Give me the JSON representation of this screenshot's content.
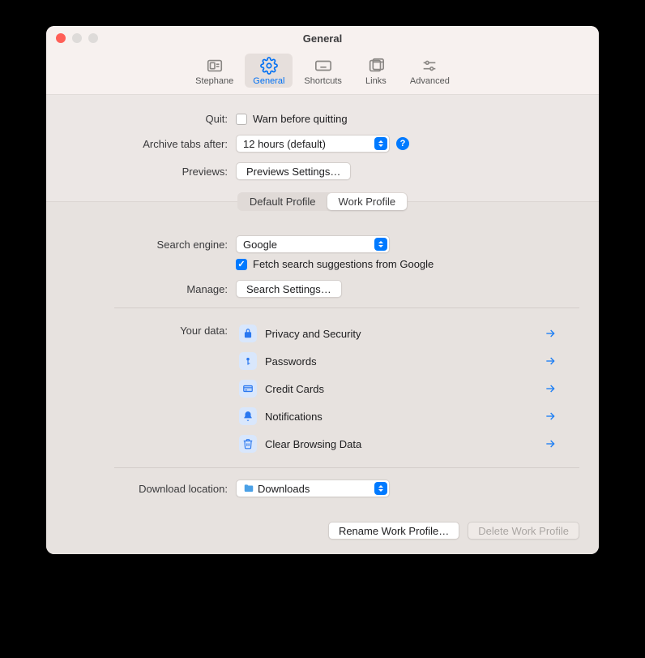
{
  "window": {
    "title": "General"
  },
  "toolbar": [
    {
      "id": "stephane",
      "label": "Stephane"
    },
    {
      "id": "general",
      "label": "General"
    },
    {
      "id": "shortcuts",
      "label": "Shortcuts"
    },
    {
      "id": "links",
      "label": "Links"
    },
    {
      "id": "advanced",
      "label": "Advanced"
    }
  ],
  "quit": {
    "label": "Quit:",
    "checkbox_label": "Warn before quitting",
    "checked": false
  },
  "archive": {
    "label": "Archive tabs after:",
    "value": "12 hours (default)"
  },
  "previews": {
    "label": "Previews:",
    "button": "Previews Settings…"
  },
  "profile_tabs": {
    "items": [
      "Default Profile",
      "Work Profile"
    ],
    "active": 1
  },
  "search": {
    "label": "Search engine:",
    "value": "Google",
    "suggest_label": "Fetch search suggestions from Google",
    "suggest_checked": true
  },
  "manage": {
    "label": "Manage:",
    "button": "Search Settings…"
  },
  "data_section": {
    "label": "Your data:",
    "items": [
      {
        "id": "privacy",
        "label": "Privacy and Security"
      },
      {
        "id": "passwords",
        "label": "Passwords"
      },
      {
        "id": "cards",
        "label": "Credit Cards"
      },
      {
        "id": "notif",
        "label": "Notifications"
      },
      {
        "id": "clear",
        "label": "Clear Browsing Data"
      }
    ]
  },
  "download": {
    "label": "Download location:",
    "value": "Downloads"
  },
  "footer": {
    "rename": "Rename Work Profile…",
    "delete": "Delete Work Profile"
  }
}
